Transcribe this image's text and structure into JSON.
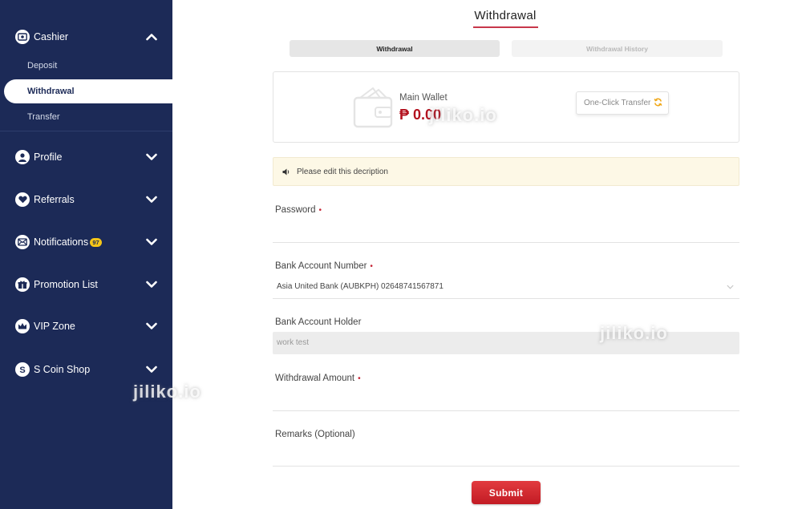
{
  "sidebar": {
    "cashier": {
      "label": "Cashier",
      "icon": "cashier-icon"
    },
    "sub_items": [
      {
        "label": "Deposit"
      },
      {
        "label": "Withdrawal"
      },
      {
        "label": "Transfer"
      }
    ],
    "items": [
      {
        "label": "Profile",
        "icon": "user-icon"
      },
      {
        "label": "Referrals",
        "icon": "heart-icon"
      },
      {
        "label": "Notifications",
        "icon": "mail-icon",
        "badge": "97"
      },
      {
        "label": "Promotion List",
        "icon": "gift-icon"
      },
      {
        "label": "VIP Zone",
        "icon": "crown-icon"
      },
      {
        "label": "S Coin Shop",
        "icon": "s-coin-icon"
      }
    ]
  },
  "page": {
    "title": "Withdrawal",
    "tabs": [
      {
        "label": "Withdrawal",
        "active": true
      },
      {
        "label": "Withdrawal History",
        "active": false
      }
    ]
  },
  "wallet": {
    "label": "Main Wallet",
    "amount": "₱ 0.00",
    "transfer_button": "One-Click Transfer"
  },
  "notice": {
    "text": "Please edit this decription"
  },
  "form": {
    "password_label": "Password",
    "bank_account_label": "Bank Account Number",
    "bank_account_value": "Asia United Bank (AUBKPH) 02648741567871",
    "holder_label": "Bank Account Holder",
    "holder_value": "work test",
    "amount_label": "Withdrawal Amount",
    "remarks_label": "Remarks (Optional)",
    "required_mark": "•",
    "submit": "Submit"
  },
  "watermark": "jiliko.io",
  "colors": {
    "sidebar_bg": "#1c2a57",
    "accent_red": "#c8374a",
    "amount_red": "#b3121f",
    "notice_bg": "#fdf8e6",
    "badge_yellow": "#f5c518"
  }
}
